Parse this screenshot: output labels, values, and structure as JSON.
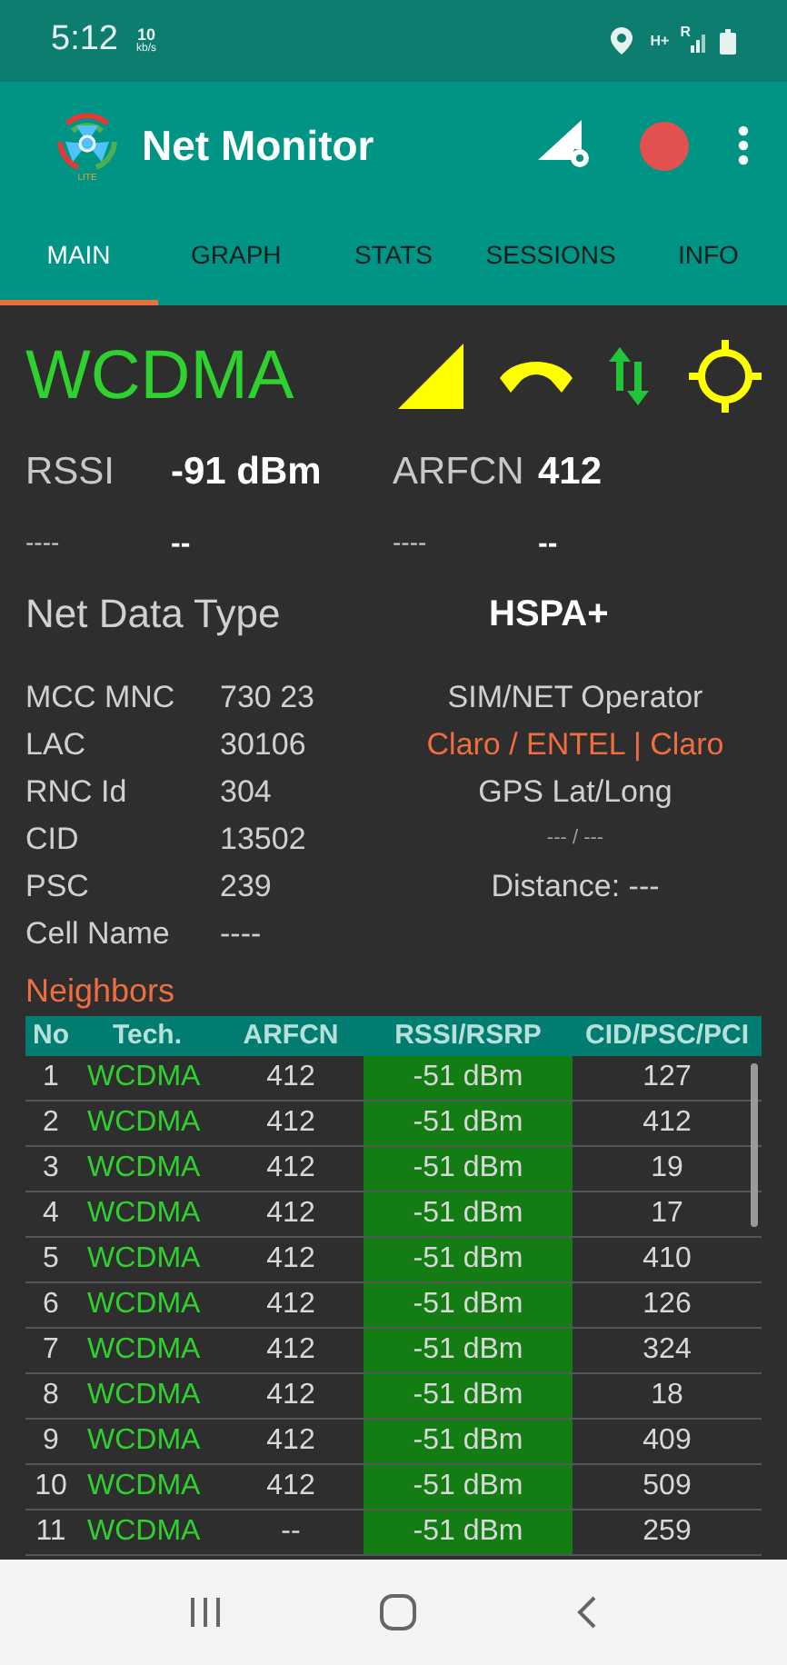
{
  "status_bar": {
    "time": "5:12",
    "speed_value": "10",
    "speed_unit": "kb/s",
    "network_type": "H+",
    "roaming": "R"
  },
  "app_bar": {
    "title": "Net Monitor",
    "logo_label": "LITE",
    "recording": true
  },
  "tabs": [
    {
      "label": "MAIN",
      "selected": true
    },
    {
      "label": "GRAPH",
      "selected": false
    },
    {
      "label": "STATS",
      "selected": false
    },
    {
      "label": "SESSIONS",
      "selected": false
    },
    {
      "label": "INFO",
      "selected": false
    }
  ],
  "main": {
    "technology": "WCDMA",
    "reading_rows": [
      {
        "kind": "primary",
        "pairs": [
          {
            "label": "RSSI",
            "value": "-91 dBm"
          },
          {
            "label": "ARFCN",
            "value": "412"
          }
        ]
      },
      {
        "kind": "secondary",
        "pairs": [
          {
            "label": "----",
            "value": "--"
          },
          {
            "label": "----",
            "value": "--"
          }
        ]
      }
    ],
    "net_data_type": {
      "label": "Net Data Type",
      "value": "HSPA+"
    },
    "cell_info": [
      {
        "label": "MCC MNC",
        "value": "730 23"
      },
      {
        "label": "LAC",
        "value": "30106"
      },
      {
        "label": "RNC Id",
        "value": "304"
      },
      {
        "label": "CID",
        "value": "13502"
      },
      {
        "label": "PSC",
        "value": "239"
      },
      {
        "label": "Cell Name",
        "value": "----"
      }
    ],
    "operator_info": [
      {
        "text": "SIM/NET Operator",
        "kind": "label"
      },
      {
        "text": "Claro / ENTEL | Claro",
        "kind": "highlight"
      },
      {
        "text": "GPS Lat/Long",
        "kind": "label"
      },
      {
        "text": "--- / ---",
        "kind": "small"
      },
      {
        "text": "Distance: ---",
        "kind": "label"
      }
    ]
  },
  "neighbors": {
    "title": "Neighbors",
    "columns": [
      "No",
      "Tech.",
      "ARFCN",
      "RSSI/RSRP",
      "CID/PSC/PCI"
    ],
    "rows": [
      [
        "1",
        "WCDMA",
        "412",
        "-51 dBm",
        "127"
      ],
      [
        "2",
        "WCDMA",
        "412",
        "-51 dBm",
        "412"
      ],
      [
        "3",
        "WCDMA",
        "412",
        "-51 dBm",
        "19"
      ],
      [
        "4",
        "WCDMA",
        "412",
        "-51 dBm",
        "17"
      ],
      [
        "5",
        "WCDMA",
        "412",
        "-51 dBm",
        "410"
      ],
      [
        "6",
        "WCDMA",
        "412",
        "-51 dBm",
        "126"
      ],
      [
        "7",
        "WCDMA",
        "412",
        "-51 dBm",
        "324"
      ],
      [
        "8",
        "WCDMA",
        "412",
        "-51 dBm",
        "18"
      ],
      [
        "9",
        "WCDMA",
        "412",
        "-51 dBm",
        "409"
      ],
      [
        "10",
        "WCDMA",
        "412",
        "-51 dBm",
        "509"
      ],
      [
        "11",
        "WCDMA",
        "--",
        "-51 dBm",
        "259"
      ]
    ]
  }
}
